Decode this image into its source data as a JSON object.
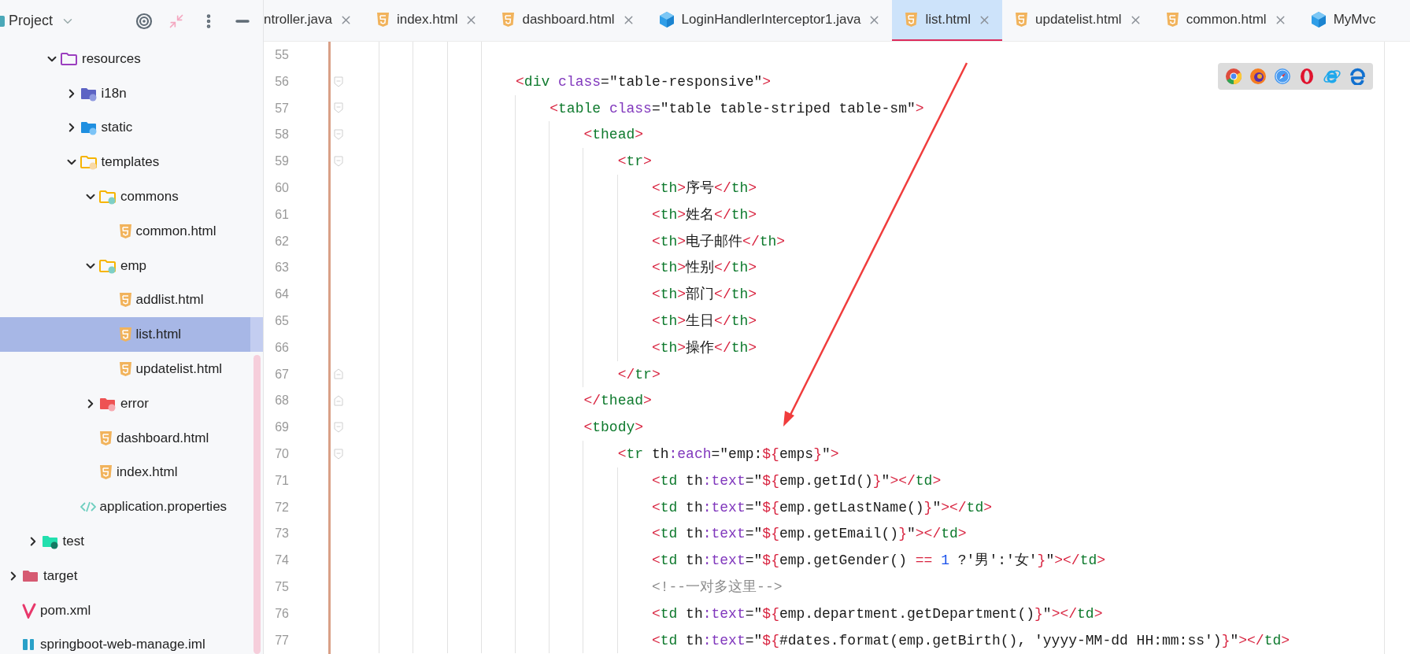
{
  "sidebar": {
    "title": "Project",
    "tree": [
      {
        "children": [
          {
            "children": [
              {
                "label": "resources",
                "kind": "resources-folder",
                "expanded": true,
                "selected": false,
                "children": [
                  {
                    "label": "i18n",
                    "kind": "i18n-folder",
                    "expanded": false,
                    "selected": false
                  },
                  {
                    "label": "static",
                    "kind": "web-folder",
                    "expanded": false,
                    "selected": false
                  },
                  {
                    "label": "templates",
                    "kind": "templates-folder",
                    "expanded": true,
                    "selected": false,
                    "children": [
                      {
                        "label": "commons",
                        "kind": "folder",
                        "expanded": true,
                        "selected": false,
                        "children": [
                          {
                            "label": "common.html",
                            "kind": "html",
                            "selected": false
                          }
                        ]
                      },
                      {
                        "label": "emp",
                        "kind": "folder",
                        "expanded": true,
                        "selected": false,
                        "children": [
                          {
                            "label": "addlist.html",
                            "kind": "html",
                            "selected": false
                          },
                          {
                            "label": "list.html",
                            "kind": "html",
                            "selected": true
                          },
                          {
                            "label": "updatelist.html",
                            "kind": "html",
                            "selected": false
                          }
                        ]
                      },
                      {
                        "label": "error",
                        "kind": "error-folder",
                        "expanded": false,
                        "selected": false
                      },
                      {
                        "label": "dashboard.html",
                        "kind": "html",
                        "selected": false
                      },
                      {
                        "label": "index.html",
                        "kind": "html",
                        "selected": false
                      }
                    ]
                  },
                  {
                    "label": "application.properties",
                    "kind": "properties",
                    "selected": false
                  }
                ]
              }
            ]
          },
          {
            "label": "test",
            "kind": "test-folder",
            "expanded": false,
            "selected": false
          }
        ]
      },
      {
        "label": "target",
        "kind": "target-folder",
        "expanded": false,
        "selected": false
      },
      {
        "label": "pom.xml",
        "kind": "maven",
        "selected": false
      },
      {
        "label": "springboot-web-manage.iml",
        "kind": "module",
        "selected": false
      }
    ]
  },
  "tabs": [
    {
      "label": "ntroller.java",
      "kind": "cut",
      "close": true,
      "selected": false
    },
    {
      "label": "index.html",
      "kind": "html",
      "close": true,
      "selected": false
    },
    {
      "label": "dashboard.html",
      "kind": "html",
      "close": true,
      "selected": false
    },
    {
      "label": "LoginHandlerInterceptor1.java",
      "kind": "java",
      "close": true,
      "selected": false
    },
    {
      "label": "list.html",
      "kind": "html",
      "close": true,
      "selected": true
    },
    {
      "label": "updatelist.html",
      "kind": "html",
      "close": true,
      "selected": false
    },
    {
      "label": "common.html",
      "kind": "html",
      "close": true,
      "selected": false
    },
    {
      "label": "MyMvc",
      "kind": "java",
      "close": false,
      "selected": false
    }
  ],
  "editor": {
    "lines": [
      {
        "number": "55",
        "kind": "plain"
      },
      {
        "number": "56",
        "kind": "block-start",
        "tokens": [
          {
            "kind": "punct",
            "text": "                    <"
          },
          {
            "kind": "tag",
            "text": "div"
          },
          {
            "kind": "attr",
            "text": " class"
          },
          {
            "kind": "plain",
            "text": "=\"table-responsive\""
          },
          {
            "kind": "punct",
            "text": ">"
          }
        ]
      },
      {
        "number": "57",
        "kind": "block-start",
        "tokens": [
          {
            "kind": "punct",
            "text": "                        <"
          },
          {
            "kind": "tag",
            "text": "table"
          },
          {
            "kind": "attr",
            "text": " class"
          },
          {
            "kind": "plain",
            "text": "=\"table table-striped table-sm\""
          },
          {
            "kind": "punct",
            "text": ">"
          }
        ]
      },
      {
        "number": "58",
        "kind": "block-start",
        "tokens": [
          {
            "kind": "punct",
            "text": "                            <"
          },
          {
            "kind": "tag",
            "text": "thead"
          },
          {
            "kind": "punct",
            "text": ">"
          }
        ]
      },
      {
        "number": "59",
        "kind": "block-start",
        "tokens": [
          {
            "kind": "punct",
            "text": "                                <"
          },
          {
            "kind": "tag",
            "text": "tr"
          },
          {
            "kind": "punct",
            "text": ">"
          }
        ]
      },
      {
        "number": "60",
        "kind": "plain",
        "tokens": [
          {
            "kind": "punct",
            "text": "                                    <"
          },
          {
            "kind": "tag",
            "text": "th"
          },
          {
            "kind": "punct",
            "text": ">"
          },
          {
            "kind": "plain",
            "text": "序号"
          },
          {
            "kind": "punct",
            "text": "</"
          },
          {
            "kind": "tag",
            "text": "th"
          },
          {
            "kind": "punct",
            "text": ">"
          }
        ]
      },
      {
        "number": "61",
        "kind": "plain",
        "tokens": [
          {
            "kind": "punct",
            "text": "                                    <"
          },
          {
            "kind": "tag",
            "text": "th"
          },
          {
            "kind": "punct",
            "text": ">"
          },
          {
            "kind": "plain",
            "text": "姓名"
          },
          {
            "kind": "punct",
            "text": "</"
          },
          {
            "kind": "tag",
            "text": "th"
          },
          {
            "kind": "punct",
            "text": ">"
          }
        ]
      },
      {
        "number": "62",
        "kind": "plain",
        "tokens": [
          {
            "kind": "punct",
            "text": "                                    <"
          },
          {
            "kind": "tag",
            "text": "th"
          },
          {
            "kind": "punct",
            "text": ">"
          },
          {
            "kind": "plain",
            "text": "电子邮件"
          },
          {
            "kind": "punct",
            "text": "</"
          },
          {
            "kind": "tag",
            "text": "th"
          },
          {
            "kind": "punct",
            "text": ">"
          }
        ]
      },
      {
        "number": "63",
        "kind": "plain",
        "tokens": [
          {
            "kind": "punct",
            "text": "                                    <"
          },
          {
            "kind": "tag",
            "text": "th"
          },
          {
            "kind": "punct",
            "text": ">"
          },
          {
            "kind": "plain",
            "text": "性别"
          },
          {
            "kind": "punct",
            "text": "</"
          },
          {
            "kind": "tag",
            "text": "th"
          },
          {
            "kind": "punct",
            "text": ">"
          }
        ]
      },
      {
        "number": "64",
        "kind": "plain",
        "tokens": [
          {
            "kind": "punct",
            "text": "                                    <"
          },
          {
            "kind": "tag",
            "text": "th"
          },
          {
            "kind": "punct",
            "text": ">"
          },
          {
            "kind": "plain",
            "text": "部门"
          },
          {
            "kind": "punct",
            "text": "</"
          },
          {
            "kind": "tag",
            "text": "th"
          },
          {
            "kind": "punct",
            "text": ">"
          }
        ]
      },
      {
        "number": "65",
        "kind": "plain",
        "tokens": [
          {
            "kind": "punct",
            "text": "                                    <"
          },
          {
            "kind": "tag",
            "text": "th"
          },
          {
            "kind": "punct",
            "text": ">"
          },
          {
            "kind": "plain",
            "text": "生日"
          },
          {
            "kind": "punct",
            "text": "</"
          },
          {
            "kind": "tag",
            "text": "th"
          },
          {
            "kind": "punct",
            "text": ">"
          }
        ]
      },
      {
        "number": "66",
        "kind": "plain",
        "tokens": [
          {
            "kind": "punct",
            "text": "                                    <"
          },
          {
            "kind": "tag",
            "text": "th"
          },
          {
            "kind": "punct",
            "text": ">"
          },
          {
            "kind": "plain",
            "text": "操作"
          },
          {
            "kind": "punct",
            "text": "</"
          },
          {
            "kind": "tag",
            "text": "th"
          },
          {
            "kind": "punct",
            "text": ">"
          }
        ]
      },
      {
        "number": "67",
        "kind": "block-end",
        "tokens": [
          {
            "kind": "punct",
            "text": "                                </"
          },
          {
            "kind": "tag",
            "text": "tr"
          },
          {
            "kind": "punct",
            "text": ">"
          }
        ]
      },
      {
        "number": "68",
        "kind": "block-end",
        "tokens": [
          {
            "kind": "punct",
            "text": "                            </"
          },
          {
            "kind": "tag",
            "text": "thead"
          },
          {
            "kind": "punct",
            "text": ">"
          }
        ]
      },
      {
        "number": "69",
        "kind": "block-start",
        "tokens": [
          {
            "kind": "punct",
            "text": "                            <"
          },
          {
            "kind": "tag",
            "text": "tbody"
          },
          {
            "kind": "punct",
            "text": ">"
          }
        ]
      },
      {
        "number": "70",
        "kind": "block-start",
        "tokens": [
          {
            "kind": "punct",
            "text": "                                <"
          },
          {
            "kind": "tag",
            "text": "tr"
          },
          {
            "kind": "plain",
            "text": " th"
          },
          {
            "kind": "attr",
            "text": ":each"
          },
          {
            "kind": "plain",
            "text": "=\"emp:"
          },
          {
            "kind": "punct",
            "text": "${"
          },
          {
            "kind": "plain",
            "text": "emps"
          },
          {
            "kind": "punct",
            "text": "}"
          },
          {
            "kind": "plain",
            "text": "\""
          },
          {
            "kind": "punct",
            "text": ">"
          }
        ]
      },
      {
        "number": "71",
        "kind": "plain",
        "tokens": [
          {
            "kind": "punct",
            "text": "                                    <"
          },
          {
            "kind": "tag",
            "text": "td"
          },
          {
            "kind": "plain",
            "text": " th"
          },
          {
            "kind": "attr",
            "text": ":text"
          },
          {
            "kind": "plain",
            "text": "=\""
          },
          {
            "kind": "punct",
            "text": "${"
          },
          {
            "kind": "plain",
            "text": "emp.getId()"
          },
          {
            "kind": "punct",
            "text": "}"
          },
          {
            "kind": "plain",
            "text": "\""
          },
          {
            "kind": "punct",
            "text": "></"
          },
          {
            "kind": "tag",
            "text": "td"
          },
          {
            "kind": "punct",
            "text": ">"
          }
        ]
      },
      {
        "number": "72",
        "kind": "plain",
        "tokens": [
          {
            "kind": "punct",
            "text": "                                    <"
          },
          {
            "kind": "tag",
            "text": "td"
          },
          {
            "kind": "plain",
            "text": " th"
          },
          {
            "kind": "attr",
            "text": ":text"
          },
          {
            "kind": "plain",
            "text": "=\""
          },
          {
            "kind": "punct",
            "text": "${"
          },
          {
            "kind": "plain",
            "text": "emp.getLastName()"
          },
          {
            "kind": "punct",
            "text": "}"
          },
          {
            "kind": "plain",
            "text": "\""
          },
          {
            "kind": "punct",
            "text": "></"
          },
          {
            "kind": "tag",
            "text": "td"
          },
          {
            "kind": "punct",
            "text": ">"
          }
        ]
      },
      {
        "number": "73",
        "kind": "plain",
        "tokens": [
          {
            "kind": "punct",
            "text": "                                    <"
          },
          {
            "kind": "tag",
            "text": "td"
          },
          {
            "kind": "plain",
            "text": " th"
          },
          {
            "kind": "attr",
            "text": ":text"
          },
          {
            "kind": "plain",
            "text": "=\""
          },
          {
            "kind": "punct",
            "text": "${"
          },
          {
            "kind": "plain",
            "text": "emp.getEmail()"
          },
          {
            "kind": "punct",
            "text": "}"
          },
          {
            "kind": "plain",
            "text": "\""
          },
          {
            "kind": "punct",
            "text": "></"
          },
          {
            "kind": "tag",
            "text": "td"
          },
          {
            "kind": "punct",
            "text": ">"
          }
        ]
      },
      {
        "number": "74",
        "kind": "plain",
        "tokens": [
          {
            "kind": "punct",
            "text": "                                    <"
          },
          {
            "kind": "tag",
            "text": "td"
          },
          {
            "kind": "plain",
            "text": " th"
          },
          {
            "kind": "attr",
            "text": ":text"
          },
          {
            "kind": "plain",
            "text": "=\""
          },
          {
            "kind": "punct",
            "text": "${"
          },
          {
            "kind": "plain",
            "text": "emp.getGender() "
          },
          {
            "kind": "punct",
            "text": "=="
          },
          {
            "kind": "number",
            "text": " 1"
          },
          {
            "kind": "plain",
            "text": " ?'男':'女'"
          },
          {
            "kind": "punct",
            "text": "}"
          },
          {
            "kind": "plain",
            "text": "\""
          },
          {
            "kind": "punct",
            "text": "></"
          },
          {
            "kind": "tag",
            "text": "td"
          },
          {
            "kind": "punct",
            "text": ">"
          }
        ]
      },
      {
        "number": "75",
        "kind": "plain",
        "tokens": [
          {
            "kind": "comment",
            "text": "                                    <!--一对多这里-->"
          }
        ]
      },
      {
        "number": "76",
        "kind": "plain",
        "tokens": [
          {
            "kind": "punct",
            "text": "                                    <"
          },
          {
            "kind": "tag",
            "text": "td"
          },
          {
            "kind": "plain",
            "text": " th"
          },
          {
            "kind": "attr",
            "text": ":text"
          },
          {
            "kind": "plain",
            "text": "=\""
          },
          {
            "kind": "punct",
            "text": "${"
          },
          {
            "kind": "plain",
            "text": "emp.department.getDepartment()"
          },
          {
            "kind": "punct",
            "text": "}"
          },
          {
            "kind": "plain",
            "text": "\""
          },
          {
            "kind": "punct",
            "text": "></"
          },
          {
            "kind": "tag",
            "text": "td"
          },
          {
            "kind": "punct",
            "text": ">"
          }
        ]
      },
      {
        "number": "77",
        "kind": "plain",
        "tokens": [
          {
            "kind": "punct",
            "text": "                                    <"
          },
          {
            "kind": "tag",
            "text": "td"
          },
          {
            "kind": "plain",
            "text": " th"
          },
          {
            "kind": "attr",
            "text": ":text"
          },
          {
            "kind": "plain",
            "text": "=\""
          },
          {
            "kind": "punct",
            "text": "${"
          },
          {
            "kind": "plain",
            "text": "#dates.format(emp.getBirth(), 'yyyy-MM-dd HH:mm:ss')"
          },
          {
            "kind": "punct",
            "text": "}"
          },
          {
            "kind": "plain",
            "text": "\""
          },
          {
            "kind": "punct",
            "text": "></"
          },
          {
            "kind": "tag",
            "text": "td"
          },
          {
            "kind": "punct",
            "text": ">"
          }
        ]
      }
    ]
  }
}
